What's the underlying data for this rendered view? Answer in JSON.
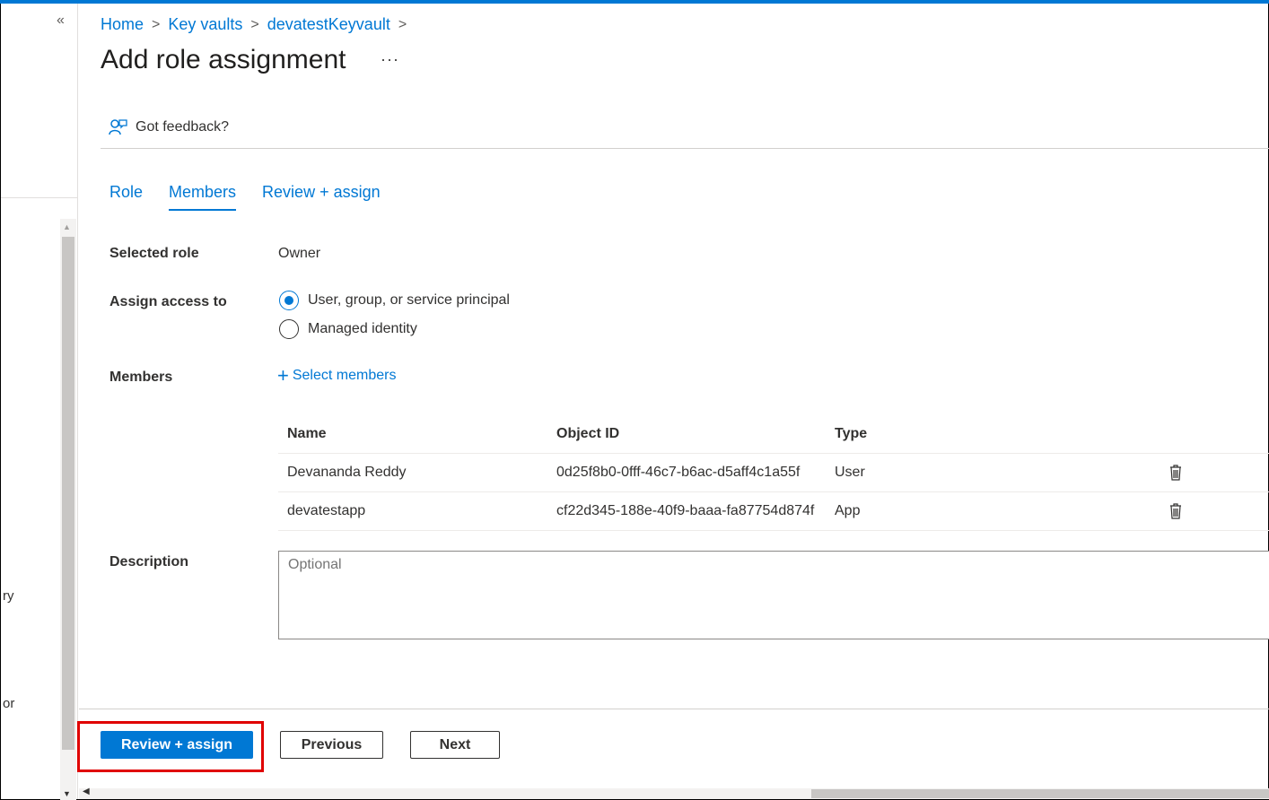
{
  "breadcrumb": [
    "Home",
    "Key vaults",
    "devatestKeyvault"
  ],
  "page_title": "Add role assignment",
  "more_label": "···",
  "feedback_label": "Got feedback?",
  "tabs": [
    {
      "label": "Role",
      "active": false
    },
    {
      "label": "Members",
      "active": true
    },
    {
      "label": "Review + assign",
      "active": false
    }
  ],
  "form": {
    "selected_role_label": "Selected role",
    "selected_role_value": "Owner",
    "assign_access_label": "Assign access to",
    "assign_options": [
      {
        "label": "User, group, or service principal",
        "checked": true
      },
      {
        "label": "Managed identity",
        "checked": false
      }
    ],
    "members_label": "Members",
    "select_members_label": "Select members",
    "description_label": "Description",
    "description_placeholder": "Optional"
  },
  "members_table": {
    "headers": [
      "Name",
      "Object ID",
      "Type"
    ],
    "rows": [
      {
        "name": "Devananda Reddy",
        "object_id": "0d25f8b0-0fff-46c7-b6ac-d5aff4c1a55f",
        "type": "User"
      },
      {
        "name": "devatestapp",
        "object_id": "cf22d345-188e-40f9-baaa-fa87754d874f",
        "type": "App"
      }
    ]
  },
  "buttons": {
    "review_assign": "Review + assign",
    "previous": "Previous",
    "next": "Next"
  },
  "left_rail": {
    "collapse_label": "«",
    "fragments": [
      "ry",
      "or"
    ]
  },
  "colors": {
    "accent": "#0078d4",
    "highlight": "#e00000"
  }
}
